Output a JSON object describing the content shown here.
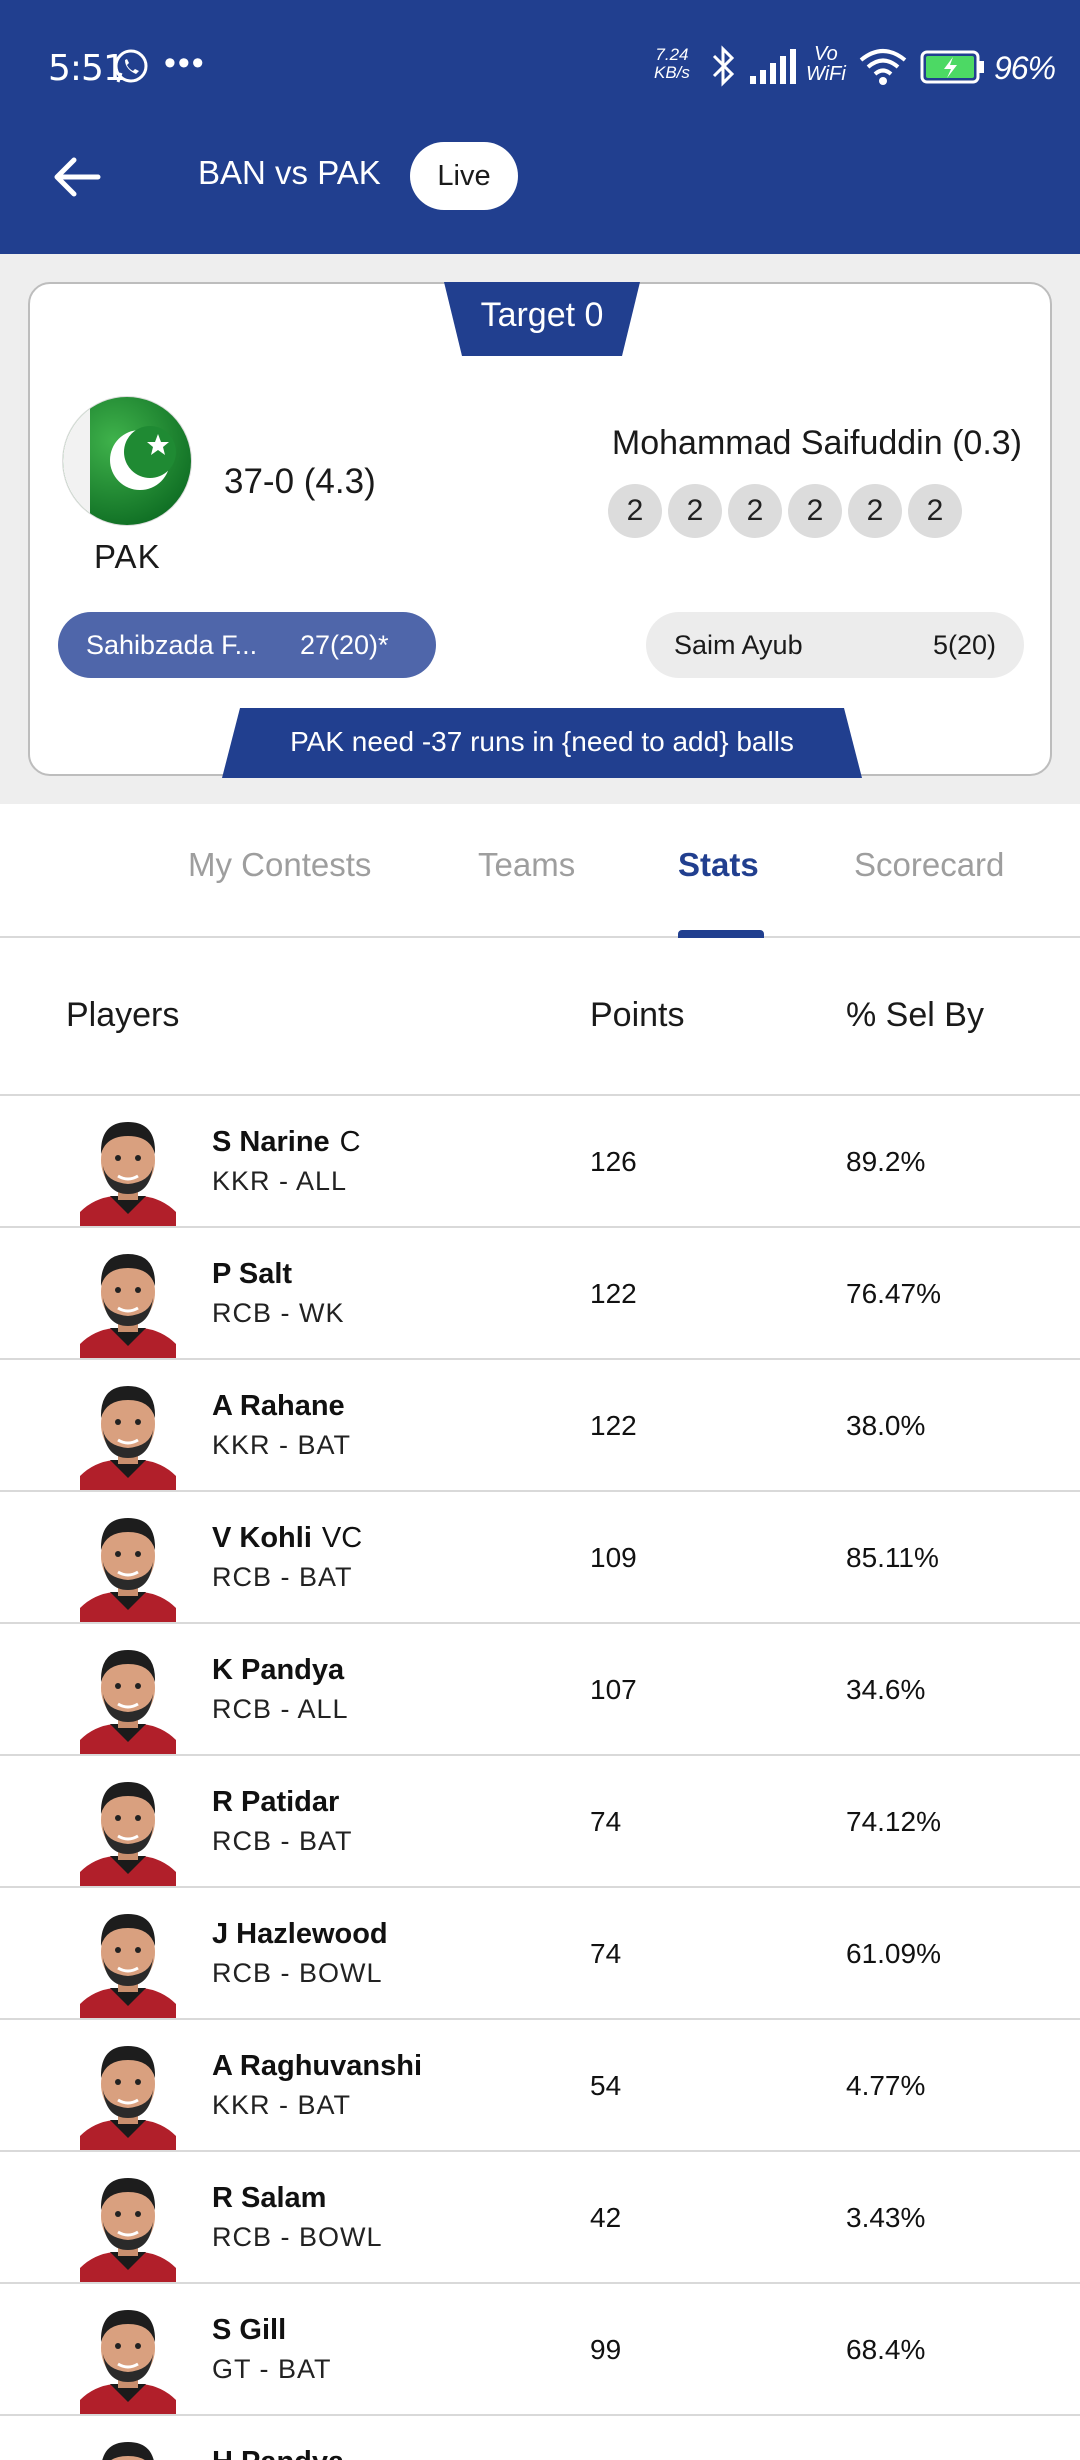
{
  "status_bar": {
    "time": "5:51",
    "net_speed_value": "7.24",
    "net_speed_unit": "KB/s",
    "vowifi_top": "Vo",
    "vowifi_bottom": "WiFi",
    "battery": "96%"
  },
  "header": {
    "title": "BAN vs PAK",
    "live_label": "Live",
    "bg_color": "#213f8f"
  },
  "score_card": {
    "target": "Target 0",
    "team": "PAK",
    "score": "37-0 (4.3)",
    "bowler": "Mohammad Saifuddin (0.3)",
    "balls": [
      "2",
      "2",
      "2",
      "2",
      "2",
      "2"
    ],
    "batsman1": {
      "name": "Sahibzada F...",
      "runs": "27(20)*"
    },
    "batsman2": {
      "name": "Saim Ayub",
      "runs": "5(20)"
    },
    "need": "PAK need -37 runs in {need to add} balls"
  },
  "tabs": [
    {
      "label": "My Contests"
    },
    {
      "label": "Teams"
    },
    {
      "label": "Stats"
    },
    {
      "label": "Scorecard"
    }
  ],
  "active_tab": "Stats",
  "table": {
    "headers": {
      "players": "Players",
      "points": "Points",
      "sel_by": "% Sel By"
    },
    "rows": [
      {
        "name": "S Narine",
        "tag": "C",
        "team": "KKR - ALL",
        "points": "126",
        "sel": "89.2%"
      },
      {
        "name": "P Salt",
        "tag": "",
        "team": "RCB - WK",
        "points": "122",
        "sel": "76.47%"
      },
      {
        "name": "A Rahane",
        "tag": "",
        "team": "KKR - BAT",
        "points": "122",
        "sel": "38.0%"
      },
      {
        "name": "V Kohli",
        "tag": "VC",
        "team": "RCB - BAT",
        "points": "109",
        "sel": "85.11%"
      },
      {
        "name": "K Pandya",
        "tag": "",
        "team": "RCB - ALL",
        "points": "107",
        "sel": "34.6%"
      },
      {
        "name": "R Patidar",
        "tag": "",
        "team": "RCB - BAT",
        "points": "74",
        "sel": "74.12%"
      },
      {
        "name": "J Hazlewood",
        "tag": "",
        "team": "RCB - BOWL",
        "points": "74",
        "sel": "61.09%"
      },
      {
        "name": "A Raghuvanshi",
        "tag": "",
        "team": "KKR - BAT",
        "points": "54",
        "sel": "4.77%"
      },
      {
        "name": "R Salam",
        "tag": "",
        "team": "RCB - BOWL",
        "points": "42",
        "sel": "3.43%"
      },
      {
        "name": "S Gill",
        "tag": "",
        "team": "GT - BAT",
        "points": "99",
        "sel": "68.4%"
      },
      {
        "name": "H Pandya",
        "tag": "",
        "team": "",
        "points": "",
        "sel": ""
      }
    ]
  }
}
